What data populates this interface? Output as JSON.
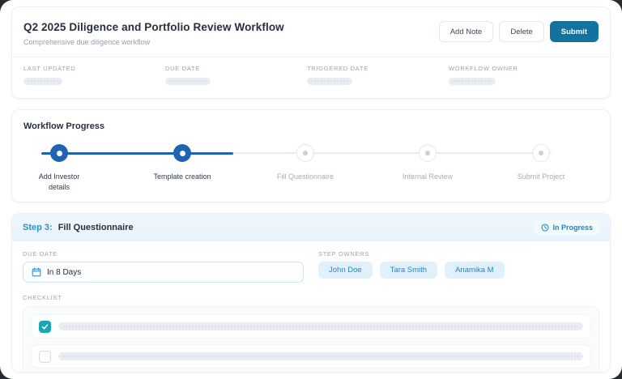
{
  "header": {
    "title": "Q2 2025 Diligence and Portfolio Review Workflow",
    "subtitle": "Comprehensive due diligence workflow",
    "buttons": {
      "add_note": "Add Note",
      "delete": "Delete",
      "submit": "Submit"
    },
    "meta": [
      {
        "label": "LAST UPDATED"
      },
      {
        "label": "DUE DATE"
      },
      {
        "label": "TRIGGERED DATE"
      },
      {
        "label": "WORKFLOW OWNER"
      }
    ]
  },
  "progress": {
    "title": "Workflow Progress",
    "steps": [
      {
        "label": "Add Investor details",
        "state": "complete"
      },
      {
        "label": "Template creation",
        "state": "complete"
      },
      {
        "label": "Fill Questionnaire",
        "state": "pending"
      },
      {
        "label": "Internal Review",
        "state": "pending"
      },
      {
        "label": "Submit Project",
        "state": "pending"
      }
    ]
  },
  "step_panel": {
    "step_label": "Step 3:",
    "step_title": "Fill Questionnaire",
    "status_badge": "In Progress",
    "due_date": {
      "label": "DUE DATE",
      "value": "In 8 Days"
    },
    "step_owners": {
      "label": "STEP OWNERS",
      "owners": [
        "John Doe",
        "Tara Smith",
        "Anamika M"
      ]
    },
    "checklist": {
      "label": "CHECKLIST",
      "items": [
        {
          "checked": true
        },
        {
          "checked": false
        }
      ]
    }
  },
  "colors": {
    "primary_button": "#13729e",
    "stepper_blue": "#1f63b3",
    "step_accent_blue": "#2d8fc8",
    "chip_text_blue": "#1b87c5",
    "chip_bg": "#e1f1fc",
    "checkbox_teal": "#1ba4b4",
    "step_header_bg": "#ecf5fc"
  }
}
